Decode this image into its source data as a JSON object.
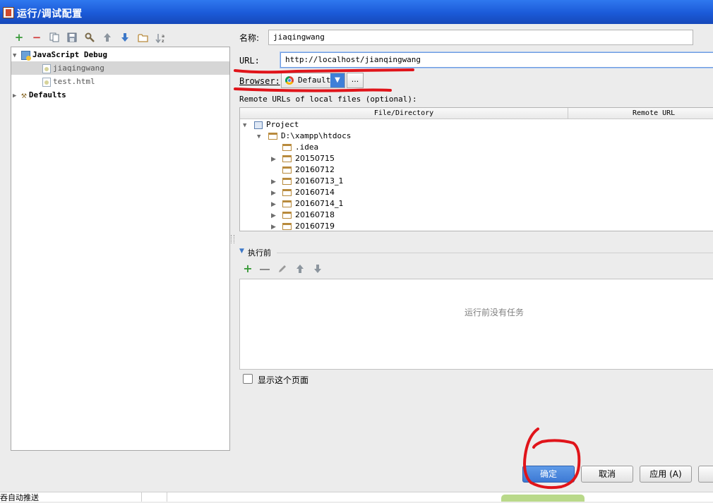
{
  "window": {
    "title": "运行/调试配置"
  },
  "toolbar": {
    "add": "+",
    "remove": "−"
  },
  "tree": {
    "items": [
      {
        "label": "JavaScript Debug"
      },
      {
        "label": "jiaqingwang"
      },
      {
        "label": "test.html"
      },
      {
        "label": "Defaults"
      }
    ]
  },
  "form": {
    "name_label": "名称:",
    "name_value": "jiaqingwang",
    "url_label": "URL:",
    "url_value": "http://localhost/jianqingwang",
    "browser_label": "Browser:",
    "browser_value": "Default",
    "browser_more": "...",
    "remote_label": "Remote URLs of local files (optional):"
  },
  "table": {
    "columns": [
      "File/Directory",
      "Remote URL"
    ],
    "rows": [
      {
        "name": "Project"
      },
      {
        "name": "D:\\xampp\\htdocs"
      },
      {
        "name": ".idea"
      },
      {
        "name": "20150715"
      },
      {
        "name": "20160712"
      },
      {
        "name": "20160713_1"
      },
      {
        "name": "20160714"
      },
      {
        "name": "20160714_1"
      },
      {
        "name": "20160718"
      },
      {
        "name": "20160719"
      }
    ]
  },
  "before_launch": {
    "title": "执行前",
    "empty_text": "运行前没有任务",
    "show_page_label": "显示这个页面",
    "show_page_checked": false
  },
  "footer": {
    "ok": "确定",
    "cancel": "取消",
    "apply": "应用 (A)"
  },
  "taskbar": {
    "fragment_text": "吞自动推送"
  },
  "colors": {
    "annotation": "#e0141a",
    "title_bar": "#1b5ad8",
    "ok_button": "#3d79d4"
  }
}
